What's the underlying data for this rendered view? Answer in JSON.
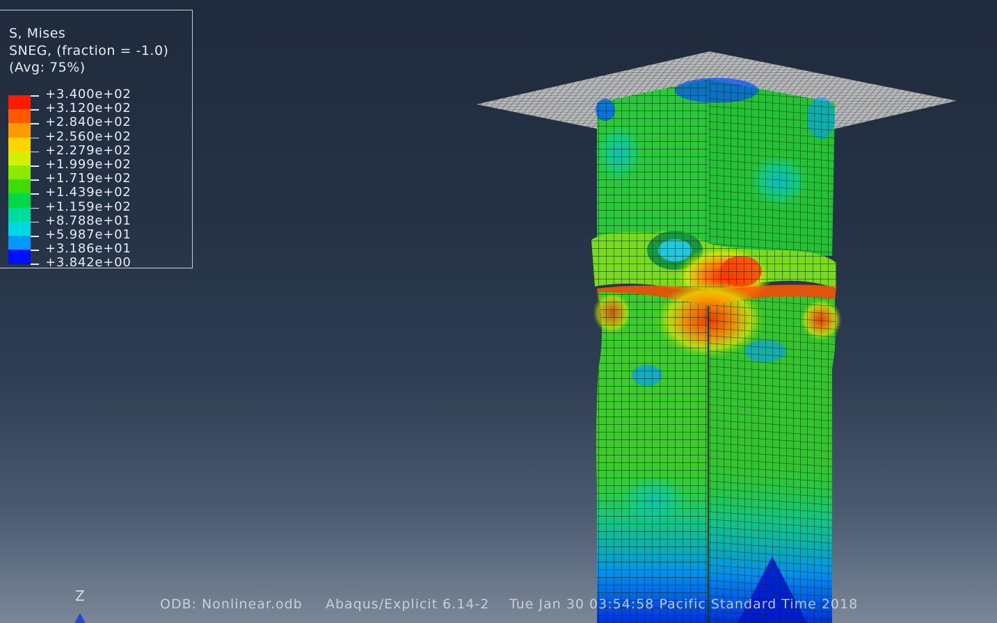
{
  "legend": {
    "title_line1": "S, Mises",
    "title_line2": "SNEG, (fraction = -1.0)",
    "title_line3": "(Avg: 75%)",
    "levels": [
      {
        "label": "+3.400e+02",
        "color": "#ff1a00"
      },
      {
        "label": "+3.120e+02",
        "color": "#ff5a00"
      },
      {
        "label": "+2.840e+02",
        "color": "#ff9a00"
      },
      {
        "label": "+2.560e+02",
        "color": "#ffd400"
      },
      {
        "label": "+2.279e+02",
        "color": "#d6ef00"
      },
      {
        "label": "+1.999e+02",
        "color": "#8ee800"
      },
      {
        "label": "+1.719e+02",
        "color": "#3fdc00"
      },
      {
        "label": "+1.439e+02",
        "color": "#00d84a"
      },
      {
        "label": "+1.159e+02",
        "color": "#00dca0"
      },
      {
        "label": "+8.788e+01",
        "color": "#00d8e6"
      },
      {
        "label": "+5.987e+01",
        "color": "#0098ff"
      },
      {
        "label": "+3.186e+01",
        "color": "#0050ff"
      },
      {
        "label": "+3.842e+00",
        "color": "#0010ff"
      }
    ]
  },
  "status": {
    "odb": "ODB: Nonlinear.odb",
    "solver": "Abaqus/Explicit 6.14-2",
    "timestamp": "Tue Jan 30 03:54:58 Pacific Standard Time 2018"
  },
  "triad": {
    "axis_label": "Z",
    "axis_color": "#2545d8"
  },
  "colors": {
    "background_top": "#1f2b3c",
    "background_bottom": "#7a8798",
    "plate_color": "#d0d0d0",
    "mesh_line": "#0a2a0a"
  }
}
